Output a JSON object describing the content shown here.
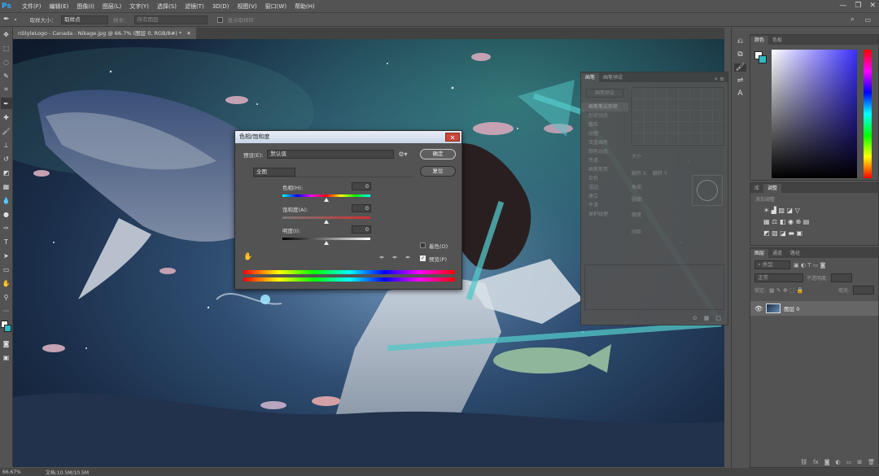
{
  "menu": {
    "logo": "Ps",
    "items": [
      "文件(F)",
      "编辑(E)",
      "图像(I)",
      "图层(L)",
      "文字(Y)",
      "选择(S)",
      "滤镜(T)",
      "3D(D)",
      "视图(V)",
      "窗口(W)",
      "帮助(H)"
    ],
    "win_controls": [
      "—",
      "❐",
      "✕"
    ]
  },
  "options_bar": {
    "size_label": "取样大小：",
    "size_value": "取样点",
    "sample_label": "样本：",
    "sample_value": "所有图层",
    "ring_label": "显示取样环"
  },
  "document": {
    "tab_title": "nStyleLogo - Canada - Nikage.jpg @ 66.7% (图层 0, RGB/8#) *"
  },
  "status": {
    "zoom": "66.67%",
    "doc_info": "文档:10.5M/10.5M"
  },
  "color_panel": {
    "tabs": [
      "颜色",
      "色板"
    ],
    "hue_color": "#3b2fff",
    "fg_color": "#ffffff",
    "bg_color": "#2fb9c3"
  },
  "adjust_panel": {
    "tabs": [
      "库",
      "调整"
    ],
    "add_label": "添加调整"
  },
  "layers_panel": {
    "tabs": [
      "图层",
      "通道",
      "路径"
    ],
    "kind_label": "类型",
    "mode_label": "正常",
    "opacity_label": "不透明度:",
    "lock_label": "锁定:",
    "fill_label": "填充:",
    "layer_name": "图层 0"
  },
  "brush_panel": {
    "tabs": [
      "画笔",
      "画笔预设"
    ],
    "preset_btn": "画笔预设",
    "items": [
      "画笔笔尖形状",
      "形状动态",
      "散布",
      "纹理",
      "双重画笔",
      "颜色动态",
      "传递",
      "画笔笔势",
      "杂色",
      "湿边",
      "建立",
      "平滑",
      "保护纹理"
    ],
    "size_label": "大小",
    "flip_x": "翻转 X",
    "flip_y": "翻转 Y",
    "angle_label": "角度:",
    "roundness_label": "圆度:",
    "hardness_label": "硬度",
    "spacing_label": "间距"
  },
  "dialog": {
    "title": "色相/饱和度",
    "close": "✕",
    "preset_label": "预设(E):",
    "preset_value": "默认值",
    "ok": "确定",
    "reset": "复位",
    "range_value": "全图",
    "hue_label": "色相(H):",
    "hue_value": "0",
    "sat_label": "饱和度(A):",
    "sat_value": "0",
    "light_label": "明度(I):",
    "light_value": "0",
    "colorize_label": "着色(O)",
    "colorize": false,
    "preview_label": "预览(P)",
    "preview": true
  }
}
